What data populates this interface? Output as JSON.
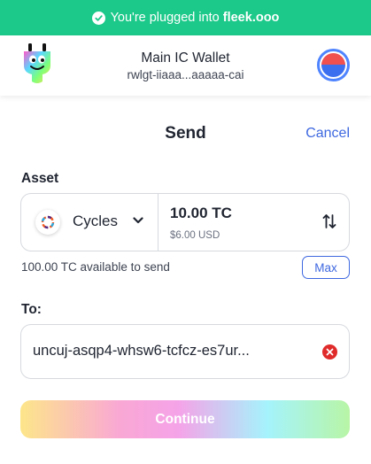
{
  "banner": {
    "text": "You're plugged into",
    "brand": "fleek.ooo",
    "color": "#1cc98a",
    "icon": "check-circle-icon"
  },
  "header": {
    "wallet_name": "Main IC Wallet",
    "wallet_id": "rwlgt-iiaaa...aaaaa-cai",
    "logo": "plug-logo",
    "avatar": "account-avatar"
  },
  "send": {
    "title": "Send",
    "cancel_label": "Cancel"
  },
  "asset": {
    "label": "Asset",
    "token_name": "Cycles",
    "token_icon": "cycles-icon",
    "amount": "10.00 TC",
    "usd_value": "$6.00 USD",
    "available": "100.00 TC available to send",
    "max_label": "Max"
  },
  "to": {
    "label": "To:",
    "value": "uncuj-asqp4-whsw6-tcfcz-es7ur..."
  },
  "continue_label": "Continue",
  "colors": {
    "accent": "#3e68e0",
    "error": "#e02b2b"
  }
}
